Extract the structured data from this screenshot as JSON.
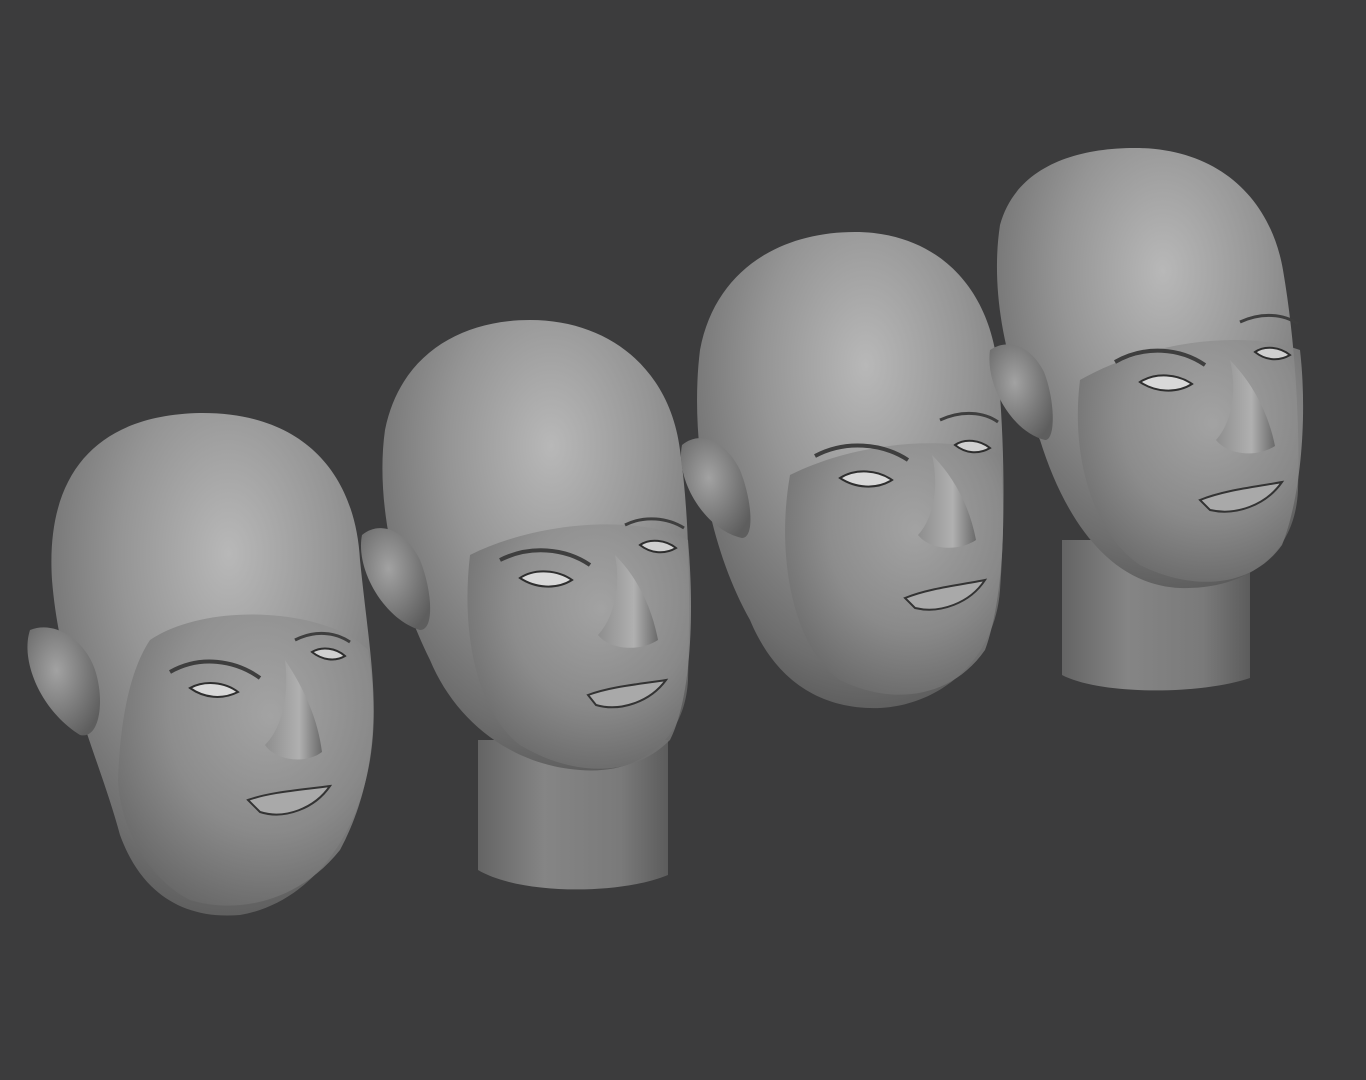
{
  "scene": {
    "background_color": "#3c3c3d",
    "material_color": "#8c8c8c",
    "highlight_color": "#bcbcbc",
    "shadow_color": "#2e2e2e",
    "models": [
      {
        "name": "head-bust-1",
        "has_neck_base": false
      },
      {
        "name": "head-bust-2",
        "has_neck_base": true
      },
      {
        "name": "head-bust-3",
        "has_neck_base": false
      },
      {
        "name": "head-bust-4",
        "has_neck_base": true
      }
    ]
  }
}
